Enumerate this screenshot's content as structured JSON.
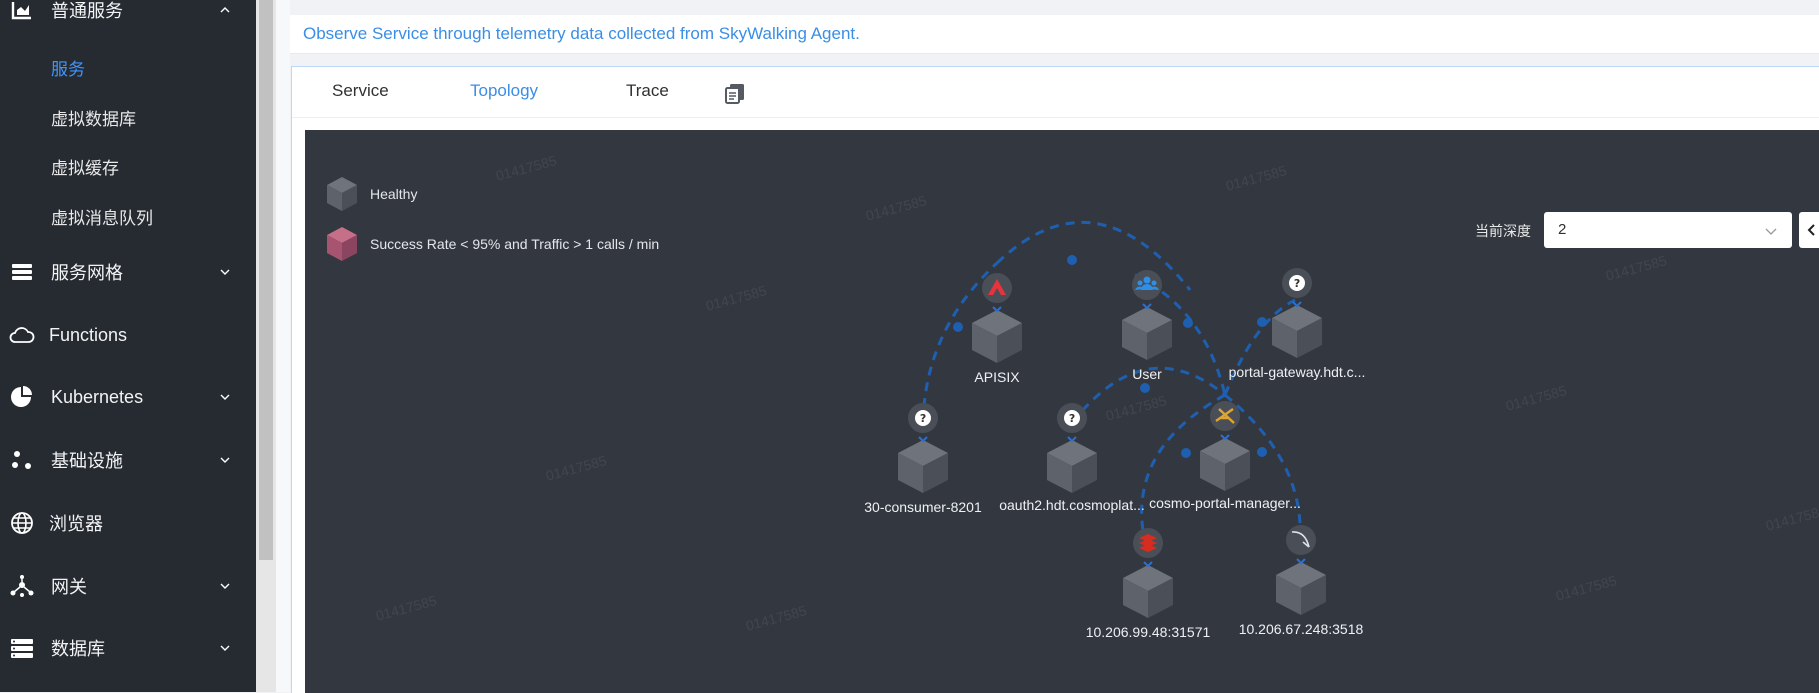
{
  "sidebar": {
    "group_general": {
      "label": "普通服务",
      "icon": "bar-chart-icon"
    },
    "sub_items": [
      {
        "label": "服务",
        "active": true
      },
      {
        "label": "虚拟数据库",
        "active": false
      },
      {
        "label": "虚拟缓存",
        "active": false
      },
      {
        "label": "虚拟消息队列",
        "active": false
      }
    ],
    "items": [
      {
        "label": "服务网格",
        "icon": "layers-icon",
        "expandable": true
      },
      {
        "label": "Functions",
        "icon": "cloud-icon",
        "expandable": false
      },
      {
        "label": "Kubernetes",
        "icon": "pie-chart-icon",
        "expandable": true
      },
      {
        "label": "基础设施",
        "icon": "nodes-icon",
        "expandable": true
      },
      {
        "label": "浏览器",
        "icon": "globe-icon",
        "expandable": false
      },
      {
        "label": "网关",
        "icon": "gateway-icon",
        "expandable": true
      },
      {
        "label": "数据库",
        "icon": "database-icon",
        "expandable": true
      }
    ]
  },
  "notice": {
    "text": "Observe Service through telemetry data collected from SkyWalking Agent."
  },
  "tabs": [
    {
      "label": "Service",
      "active": false
    },
    {
      "label": "Topology",
      "active": true
    },
    {
      "label": "Trace",
      "active": false
    }
  ],
  "copy_icon": "copy-document-icon",
  "topology": {
    "legend": [
      {
        "label": "Healthy",
        "color": "#5a5f68"
      },
      {
        "label": "Success Rate < 95% and Traffic > 1 calls / min",
        "color": "#b85a77"
      }
    ],
    "depth": {
      "label": "当前深度",
      "value": "2"
    },
    "nodes": [
      {
        "id": "apisix",
        "label": "APISIX",
        "icon": "apisix-icon"
      },
      {
        "id": "user",
        "label": "User",
        "icon": "user-group-icon"
      },
      {
        "id": "portal-gateway",
        "label": "portal-gateway.hdt.c...",
        "icon": "unknown-icon"
      },
      {
        "id": "consumer",
        "label": "30-consumer-8201",
        "icon": "unknown-icon"
      },
      {
        "id": "oauth2",
        "label": "oauth2.hdt.cosmoplat...",
        "icon": "unknown-icon"
      },
      {
        "id": "cosmo",
        "label": "cosmo-portal-manager...",
        "icon": "spring-icon"
      },
      {
        "id": "redis",
        "label": "10.206.99.48:31571",
        "icon": "redis-icon"
      },
      {
        "id": "mysql",
        "label": "10.206.67.248:3518",
        "icon": "mysql-icon"
      }
    ],
    "colors": {
      "background": "#333840",
      "line": "#1f5fb0",
      "cube_top": "#6e737c",
      "cube_left": "#5d626b",
      "cube_right": "#4b5058"
    }
  },
  "watermark": "01417585"
}
